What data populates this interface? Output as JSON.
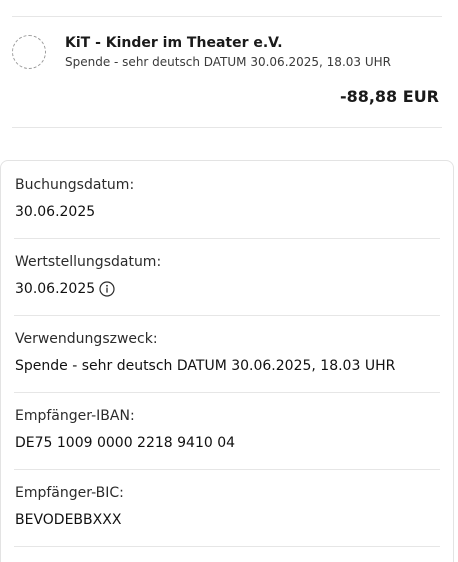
{
  "transaction": {
    "merchant_name": "KiT - Kinder im Theater e.V.",
    "subtitle": "Spende - sehr deutsch DATUM 30.06.2025, 18.03 UHR",
    "amount": "-88,88 EUR"
  },
  "details": {
    "booking_date_label": "Buchungsdatum:",
    "booking_date_value": "30.06.2025",
    "value_date_label": "Wertstellungsdatum:",
    "value_date_value": "30.06.2025",
    "purpose_label": "Verwendungszweck:",
    "purpose_value": "Spende - sehr deutsch DATUM 30.06.2025, 18.03 UHR",
    "iban_label": "Empfänger-IBAN:",
    "iban_value": "DE75 1009 0000 2218 9410 04",
    "bic_label": "Empfänger-BIC:",
    "bic_value": "BEVODEBBXXX"
  },
  "icons": {
    "merchant_avatar": "merchant-avatar-placeholder",
    "value_date_info": "info-icon"
  }
}
